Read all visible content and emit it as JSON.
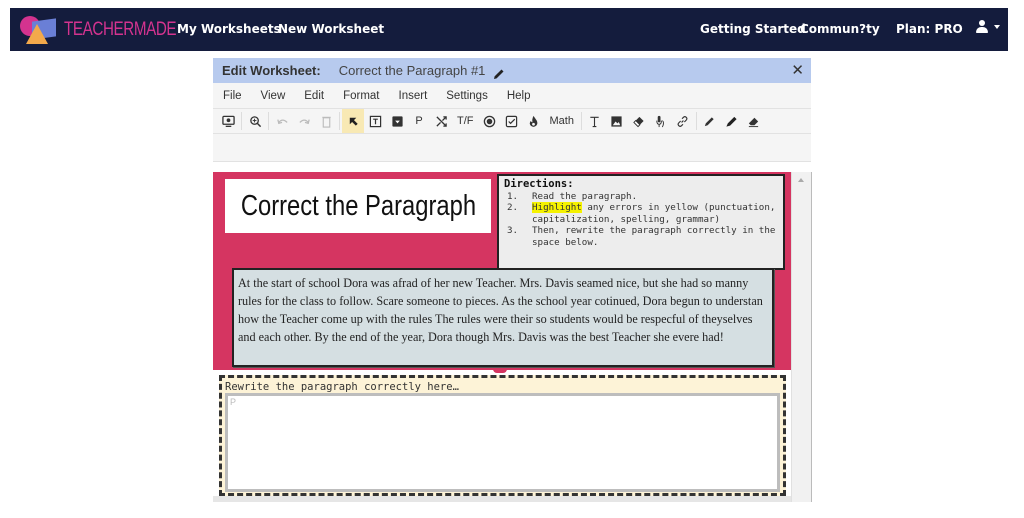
{
  "navbar": {
    "brand": "TEACHERMADE",
    "links": [
      "My Worksheets",
      "New Worksheet"
    ],
    "right_links": [
      "Getting Started",
      "Commun?ty",
      "Plan: PRO"
    ],
    "user_icon": "user-icon",
    "colors": {
      "background": "#141c3d",
      "brand": "#d4338f"
    }
  },
  "editor": {
    "header_label": "Edit Worksheet:",
    "worksheet_title": "Correct the Paragraph #1",
    "close_label": "✕",
    "menu": [
      "File",
      "View",
      "Edit",
      "Format",
      "Insert",
      "Settings",
      "Help"
    ],
    "toolbar": {
      "items": [
        {
          "icon": "preview-icon"
        },
        {
          "icon": "zoom-icon"
        },
        {
          "icon": "undo-icon",
          "disabled": true
        },
        {
          "icon": "redo-icon",
          "disabled": true
        },
        {
          "icon": "delete-icon",
          "disabled": true
        },
        {
          "icon": "select-pointer-icon",
          "active": true
        },
        {
          "icon": "text-box-icon"
        },
        {
          "icon": "dropdown-icon"
        },
        {
          "label": "P"
        },
        {
          "icon": "shuffle-icon"
        },
        {
          "label": "T/F"
        },
        {
          "icon": "radio-icon"
        },
        {
          "icon": "checkbox-icon"
        },
        {
          "icon": "fire-icon"
        },
        {
          "label": "Math"
        },
        {
          "icon": "text-icon"
        },
        {
          "icon": "image-icon"
        },
        {
          "icon": "eraser-icon"
        },
        {
          "icon": "audio-icon"
        },
        {
          "icon": "link-icon"
        },
        {
          "icon": "pen-icon"
        },
        {
          "icon": "marker-icon"
        },
        {
          "icon": "highlighter-eraser-icon"
        }
      ]
    }
  },
  "worksheet": {
    "title": "Correct the Paragraph",
    "directions": {
      "heading": "Directions:",
      "steps": [
        {
          "num": "1.",
          "text": "Read the paragraph."
        },
        {
          "num": "2.",
          "highlight": "Highlight",
          "text": " any errors in yellow (punctuation, capitalization, spelling, grammar)"
        },
        {
          "num": "3.",
          "text": "Then, rewrite the paragraph correctly in the space below."
        }
      ]
    },
    "paragraph": "At the start of  school Dora was afrad of  her new Teacher. Mrs. Davis seamed nice, but she had so manny rules for the class to follow. Scare  someone to pieces. As the school year cotinued, Dora begun to understan how the Teacher come up with the rules The rules were their so students would be respecful of  theyselves and each other. By the end of  the year, Dora though Mrs. Davis was the best Teacher she evere had!",
    "rewrite_label": "Rewrite the paragraph correctly here…",
    "answer_value": "P",
    "colors": {
      "accent": "#d53561",
      "paragraph_bg": "#d5dfe2",
      "rewrite_bg": "#fdf3d7",
      "highlight": "#f5f200"
    }
  }
}
